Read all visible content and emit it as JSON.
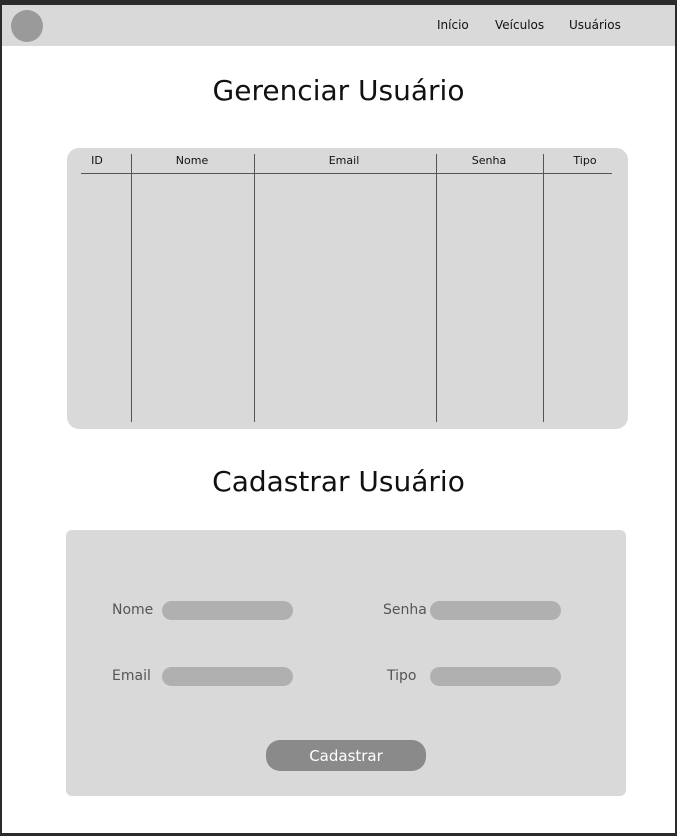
{
  "navbar": {
    "items": [
      {
        "label": "Início"
      },
      {
        "label": "Veículos"
      },
      {
        "label": "Usuários"
      }
    ]
  },
  "manage": {
    "title": "Gerenciar Usuário",
    "table": {
      "columns": [
        "ID",
        "Nome",
        "Email",
        "Senha",
        "Tipo"
      ],
      "rows": []
    }
  },
  "register": {
    "title": "Cadastrar Usuário",
    "fields": {
      "nome": {
        "label": "Nome",
        "value": ""
      },
      "senha": {
        "label": "Senha",
        "value": ""
      },
      "email": {
        "label": "Email",
        "value": ""
      },
      "tipo": {
        "label": "Tipo",
        "value": ""
      }
    },
    "submit_label": "Cadastrar"
  }
}
